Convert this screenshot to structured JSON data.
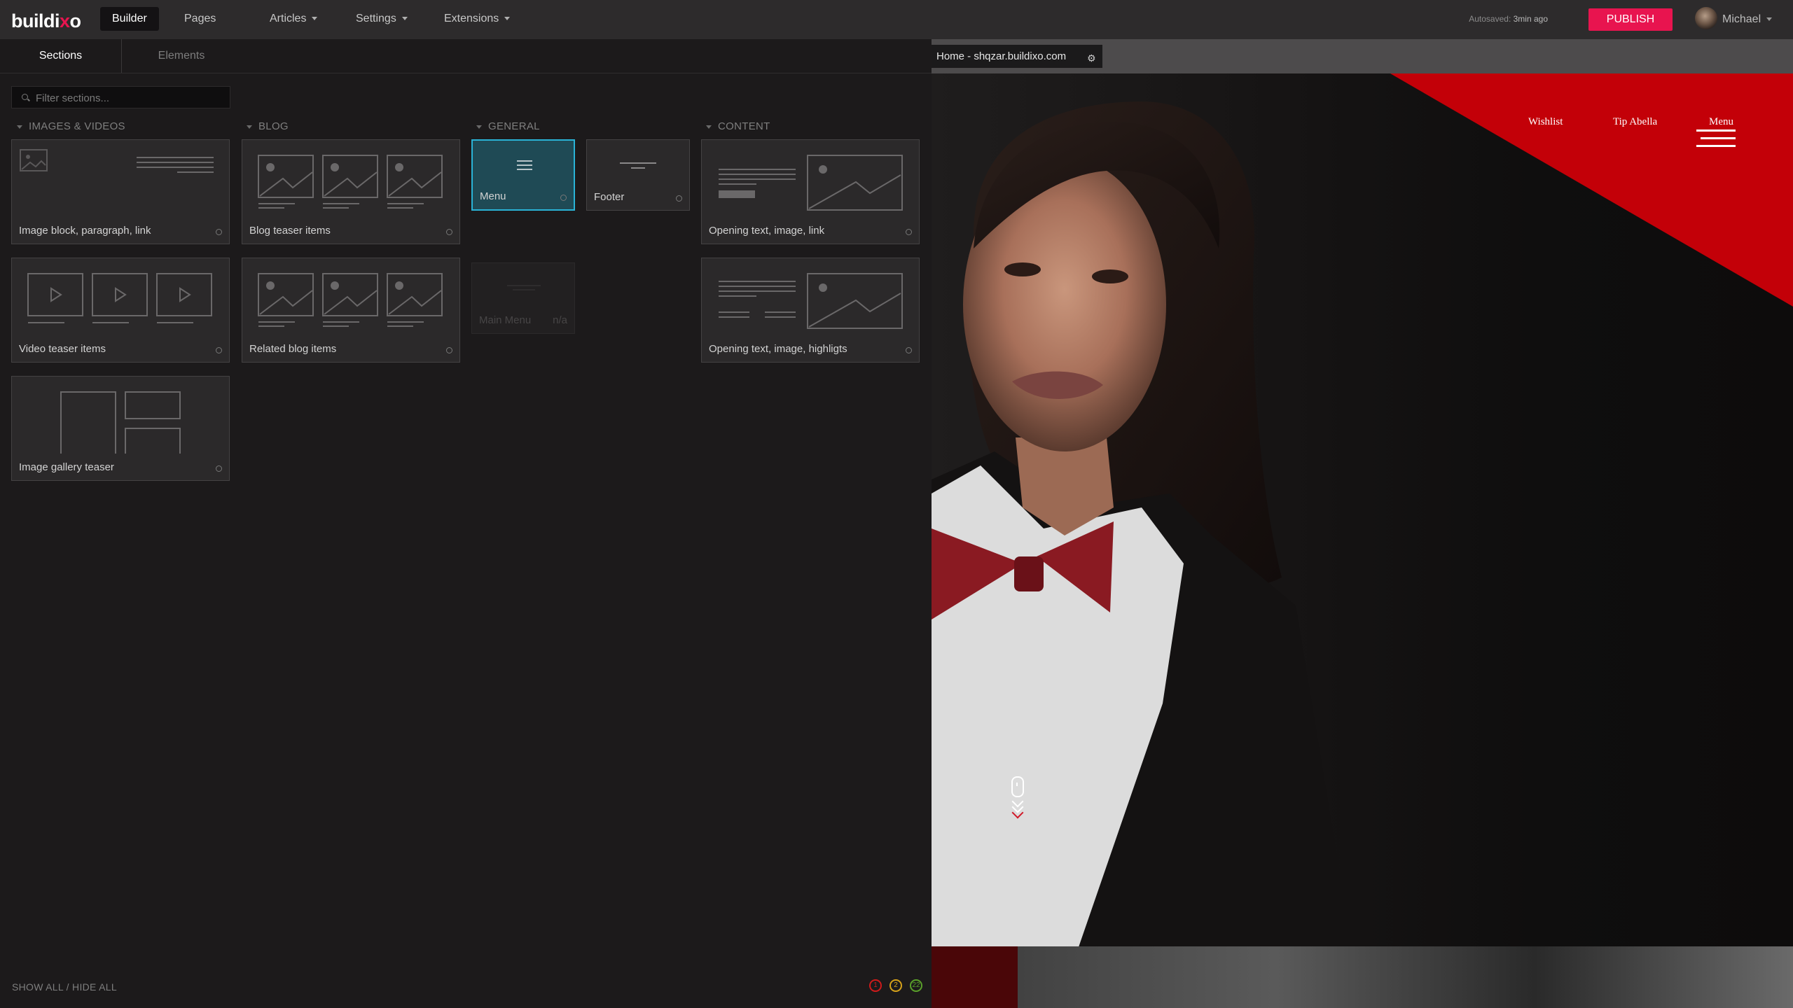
{
  "app": {
    "logo": {
      "part1": "buildi",
      "part2": "x",
      "part3": "o"
    },
    "nav": [
      {
        "label": "Builder"
      },
      {
        "label": "Pages"
      },
      {
        "label": "Articles"
      },
      {
        "label": "Settings"
      },
      {
        "label": "Extensions"
      }
    ],
    "autosave": {
      "prefix": "Autosaved:",
      "time": "3min ago"
    },
    "publish_label": "PUBLISH",
    "user_name": "Michael"
  },
  "left_panel": {
    "tabs": [
      {
        "label": "Sections"
      },
      {
        "label": "Elements"
      }
    ],
    "filter": {
      "placeholder": "Filter sections...",
      "value": ""
    },
    "categories": [
      {
        "label": "IMAGES & VIDEOS"
      },
      {
        "label": "BLOG"
      },
      {
        "label": "GENERAL"
      },
      {
        "label": "CONTENT"
      }
    ],
    "sections": {
      "image_block": "Image block, paragraph, link",
      "video_teaser": "Video teaser items",
      "gallery_teaser": "Image gallery teaser",
      "blog_teaser": "Blog teaser items",
      "related_blog": "Related blog items",
      "menu": "Menu",
      "main_menu": "Main Menu",
      "main_menu_status": "n/a",
      "footer": "Footer",
      "opening_link": "Opening text, image, link",
      "opening_highlights": "Opening text, image, highligts"
    },
    "selected": "Menu",
    "footer": {
      "show_all": "SHOW ALL",
      "separator": " / ",
      "hide_all": "HIDE ALL"
    },
    "badges": [
      {
        "value": "1",
        "color": "#d01a1a"
      },
      {
        "value": "2",
        "color": "#d6a21a"
      },
      {
        "value": "22",
        "color": "#5aa02a"
      }
    ]
  },
  "preview": {
    "url_label": "Home - shqzar.buildixo.com",
    "gear_icon": "gear-icon",
    "site_nav": [
      {
        "label": "Wishlist"
      },
      {
        "label": "Tip Abella"
      },
      {
        "label": "Menu"
      }
    ],
    "accent_color": "#c30008"
  }
}
